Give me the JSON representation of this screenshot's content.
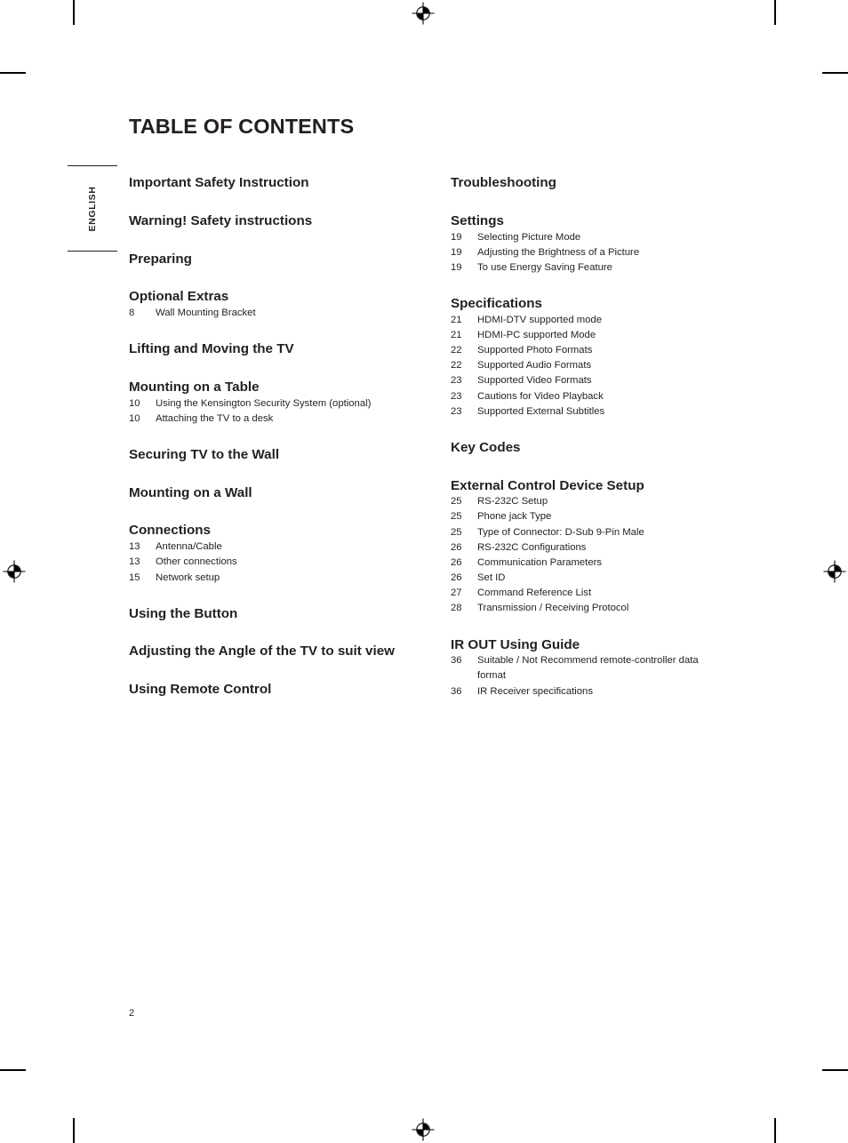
{
  "document": {
    "title": "TABLE OF CONTENTS",
    "language_tab": "ENGLISH",
    "page_number": "2",
    "ink_color": "#231f20"
  },
  "toc": {
    "left_column": [
      {
        "heading": "Important Safety Instruction",
        "entries": []
      },
      {
        "heading": "Warning! Safety instructions",
        "entries": []
      },
      {
        "heading": "Preparing",
        "entries": []
      },
      {
        "heading": "Optional Extras",
        "entries": [
          {
            "page": "8",
            "label": "Wall Mounting Bracket"
          }
        ]
      },
      {
        "heading": "Lifting and Moving the TV",
        "entries": []
      },
      {
        "heading": "Mounting on a Table",
        "entries": [
          {
            "page": "10",
            "label": "Using the Kensington Security System (optional)"
          },
          {
            "page": "10",
            "label": "Attaching the TV to a desk"
          }
        ]
      },
      {
        "heading": "Securing TV to the Wall",
        "entries": []
      },
      {
        "heading": "Mounting on a Wall",
        "entries": []
      },
      {
        "heading": "Connections",
        "entries": [
          {
            "page": "13",
            "label": "Antenna/Cable"
          },
          {
            "page": "13",
            "label": "Other connections"
          },
          {
            "page": "15",
            "label": "Network setup"
          }
        ]
      },
      {
        "heading": "Using the Button",
        "entries": []
      },
      {
        "heading": "Adjusting the Angle of the TV to suit view",
        "entries": []
      },
      {
        "heading": "Using Remote Control",
        "entries": []
      }
    ],
    "right_column": [
      {
        "heading": "Troubleshooting",
        "entries": []
      },
      {
        "heading": "Settings",
        "entries": [
          {
            "page": "19",
            "label": "Selecting Picture Mode"
          },
          {
            "page": "19",
            "label": "Adjusting the Brightness of a Picture"
          },
          {
            "page": "19",
            "label": "To use Energy Saving Feature"
          }
        ]
      },
      {
        "heading": "Specifications",
        "entries": [
          {
            "page": "21",
            "label": "HDMI-DTV supported mode"
          },
          {
            "page": "21",
            "label": "HDMI-PC supported Mode"
          },
          {
            "page": "22",
            "label": "Supported Photo Formats"
          },
          {
            "page": "22",
            "label": "Supported Audio Formats"
          },
          {
            "page": "23",
            "label": "Supported Video Formats"
          },
          {
            "page": "23",
            "label": "Cautions for Video Playback"
          },
          {
            "page": "23",
            "label": "Supported External Subtitles"
          }
        ]
      },
      {
        "heading": "Key Codes",
        "entries": []
      },
      {
        "heading": "External Control Device Setup",
        "entries": [
          {
            "page": "25",
            "label": "RS-232C Setup"
          },
          {
            "page": "25",
            "label": "Phone jack Type"
          },
          {
            "page": "25",
            "label": "Type of Connector: D-Sub 9-Pin Male"
          },
          {
            "page": "26",
            "label": "RS-232C Configurations"
          },
          {
            "page": "26",
            "label": "Communication Parameters"
          },
          {
            "page": "26",
            "label": "Set ID"
          },
          {
            "page": "27",
            "label": "Command Reference List"
          },
          {
            "page": "28",
            "label": "Transmission / Receiving Protocol"
          }
        ]
      },
      {
        "heading": "IR OUT Using Guide",
        "entries": [
          {
            "page": "36",
            "label": "Suitable / Not Recommend remote-controller data format"
          },
          {
            "page": "36",
            "label": "IR Receiver specifications"
          }
        ]
      }
    ]
  },
  "print_marks": {
    "registration_icon": "registration-target-icon",
    "crop_mark_icon": "crop-mark"
  }
}
